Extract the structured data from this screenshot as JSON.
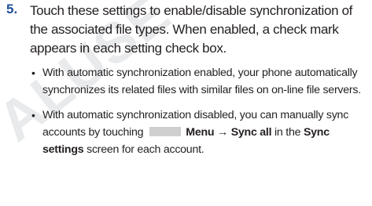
{
  "watermark": "ALUSE",
  "step": {
    "number": "5.",
    "text": "Touch these settings to enable/disable synchronization of the associated file types. When enabled, a check mark appears in each setting check box."
  },
  "bullets": [
    {
      "text": "With automatic synchronization enabled, your phone automatically synchronizes its related files with similar files on on-line file servers."
    },
    {
      "text_before": "With automatic synchronization disabled, you can manually sync accounts by touching",
      "menu_icon": "menu-key-icon",
      "menu_label": "Menu",
      "arrow": "→",
      "sync_all_label": "Sync all",
      "text_middle": "in the",
      "sync_settings_label": "Sync settings",
      "text_after": "screen for each account."
    }
  ]
}
